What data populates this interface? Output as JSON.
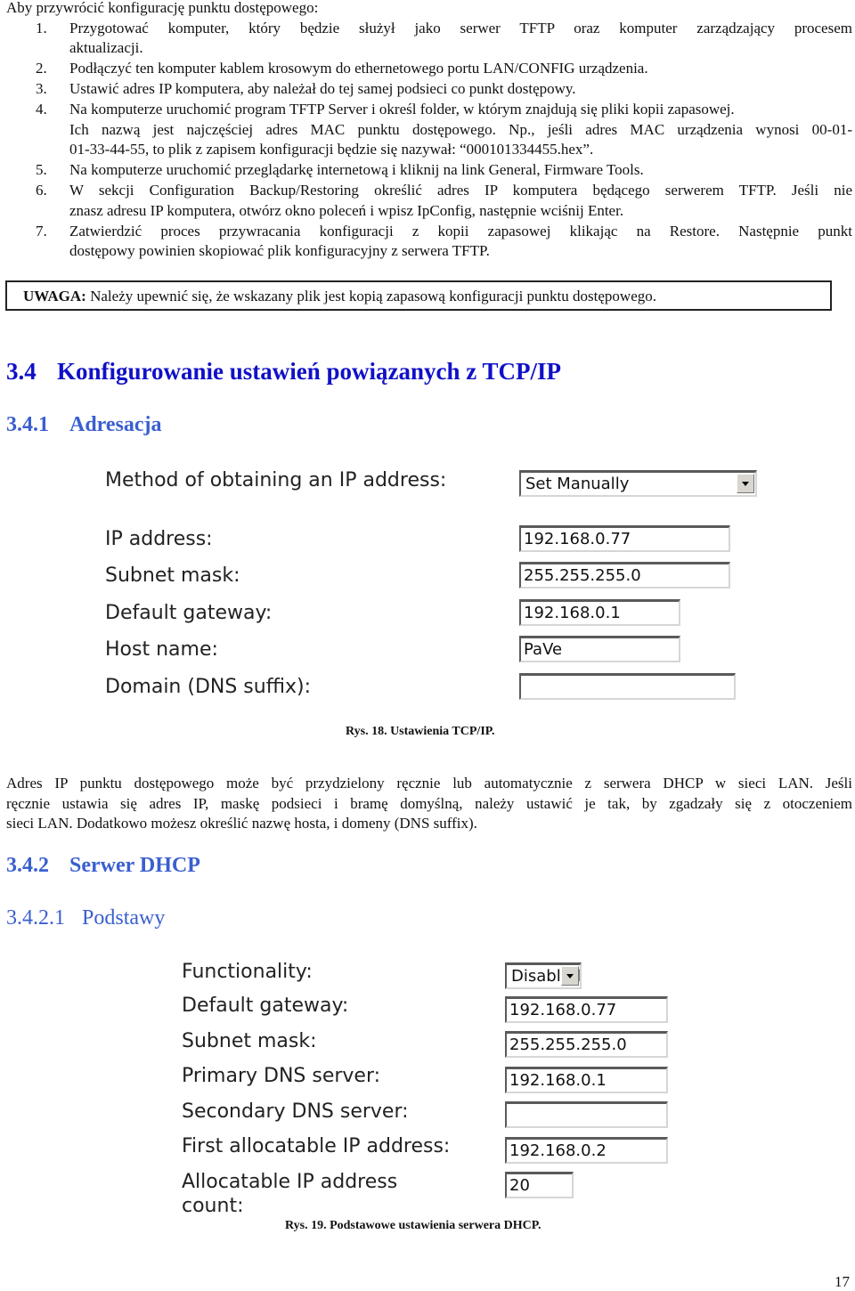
{
  "intro": "Aby przywrócić konfigurację punktu dostępowego:",
  "steps": [
    {
      "num": "1.",
      "lines": [
        "Przygotować komputer, który będzie służył jako serwer TFTP oraz komputer zarządzający procesem",
        "aktualizacji."
      ]
    },
    {
      "num": "2.",
      "lines": [
        "Podłączyć ten komputer kablem krosowym do ethernetowego portu LAN/CONFIG urządzenia."
      ]
    },
    {
      "num": "3.",
      "lines": [
        "Ustawić adres IP komputera, aby należał do tej samej podsieci co punkt dostępowy."
      ]
    },
    {
      "num": "4.",
      "lines": [
        "Na komputerze uruchomić program TFTP Server i określ folder, w którym znajdują się pliki kopii zapasowej.",
        "Ich nazwą jest najczęściej adres MAC punktu dostępowego. Np., jeśli adres MAC urządzenia wynosi 00-01-",
        "01-33-44-55, to plik z zapisem konfiguracji będzie się nazywał: “000101334455.hex”."
      ]
    },
    {
      "num": "5.",
      "lines": [
        "Na komputerze uruchomić przeglądarkę internetową i kliknij na link General, Firmware Tools."
      ]
    },
    {
      "num": "6.",
      "lines": [
        "W sekcji Configuration Backup/Restoring określić adres IP komputera będącego serwerem TFTP. Jeśli nie",
        "znasz adresu IP komputera, otwórz okno poleceń i wpisz IpConfig, następnie wciśnij Enter."
      ]
    },
    {
      "num": "7.",
      "lines": [
        "Zatwierdzić proces przywracania konfiguracji z kopii zapasowej klikając na Restore. Następnie punkt",
        "dostępowy powinien skopiować plik konfiguracyjny z serwera TFTP."
      ]
    }
  ],
  "note": {
    "label": "UWAGA:",
    "text": " Należy upewnić się, że wskazany plik jest kopią zapasową konfiguracji punktu dostępowego."
  },
  "section_34": {
    "number": "3.4",
    "title": "Konfigurowanie ustawień powiązanych z TCP/IP"
  },
  "section_341": {
    "number": "3.4.1",
    "title": "Adresacja"
  },
  "tcpip_form": {
    "method_label": "Method of obtaining an IP address:",
    "method_value": "Set Manually",
    "ip_label": "IP address:",
    "ip_value": "192.168.0.77",
    "mask_label": "Subnet mask:",
    "mask_value": "255.255.255.0",
    "gateway_label": "Default gateway:",
    "gateway_value": "192.168.0.1",
    "host_label": "Host name:",
    "host_value": "PaVe",
    "domain_label": "Domain (DNS suffix):",
    "domain_value": ""
  },
  "caption_18": "Rys. 18. Ustawienia TCP/IP.",
  "paragraph": [
    "Adres IP punktu dostępowego może być przydzielony ręcznie lub automatycznie z serwera DHCP w sieci LAN. Jeśli",
    "ręcznie ustawia się adres IP, maskę podsieci i bramę domyślną, należy ustawić je tak, by zgadzały się z otoczeniem",
    "sieci LAN. Dodatkowo możesz określić nazwę hosta, i domeny (DNS suffix)."
  ],
  "section_342": {
    "number": "3.4.2",
    "title": "Serwer DHCP"
  },
  "section_3421": {
    "number": "3.4.2.1",
    "title": "Podstawy"
  },
  "dhcp_form": {
    "functionality_label": "Functionality:",
    "functionality_value": "Disabled",
    "gateway_label": "Default gateway:",
    "gateway_value": "192.168.0.77",
    "mask_label": "Subnet mask:",
    "mask_value": "255.255.255.0",
    "primary_dns_label": "Primary DNS server:",
    "primary_dns_value": "192.168.0.1",
    "secondary_dns_label": "Secondary DNS server:",
    "secondary_dns_value": "",
    "first_ip_label": "First allocatable IP address:",
    "first_ip_value": "192.168.0.2",
    "count_label_1": "Allocatable IP address",
    "count_label_2": "count:",
    "count_value": "20"
  },
  "caption_19": "Rys. 19. Podstawowe ustawienia serwera DHCP.",
  "page_number": "17"
}
